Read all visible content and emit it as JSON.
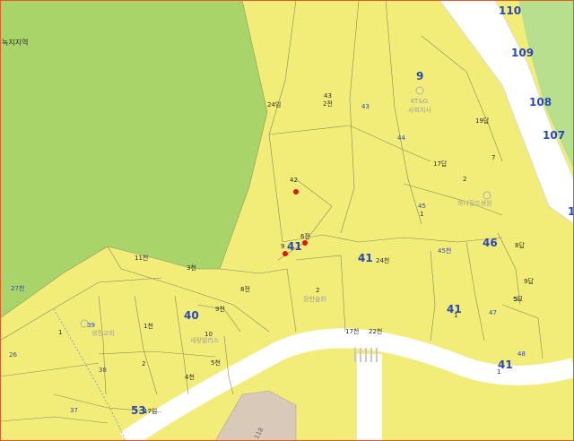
{
  "map": {
    "colors": {
      "residential": "#f2ec78",
      "green_zone": "#a9d46a",
      "east_green": "#b7df8e",
      "road": "#ffffff",
      "parcel_line": "#8a8a55",
      "lot_marker": "#e01414",
      "building": "#d9c9b8",
      "number_label": "#2a48b8",
      "frame": "#e05a2a"
    },
    "zone_label": "녹지지역",
    "road_label": "118",
    "block_numbers": [
      {
        "text": "110",
        "icon": "none"
      },
      {
        "text": "109",
        "icon": "none"
      },
      {
        "text": "108",
        "icon": "none"
      },
      {
        "text": "107",
        "icon": "none"
      },
      {
        "text": "1",
        "icon": "none"
      },
      {
        "text": "9",
        "icon": "none"
      },
      {
        "text": "41",
        "icon": "none"
      },
      {
        "text": "41",
        "icon": "none"
      },
      {
        "text": "46",
        "icon": "none"
      },
      {
        "text": "41",
        "icon": "none"
      },
      {
        "text": "41",
        "icon": "none"
      },
      {
        "text": "40",
        "icon": "none"
      },
      {
        "text": "53",
        "icon": "none"
      }
    ],
    "small_blue_numbers": [
      "43",
      "44",
      "45",
      "45천",
      "47",
      "48",
      "39",
      "38",
      "37",
      "26",
      "27천",
      "5"
    ],
    "lot_labels": [
      "24임",
      "43",
      "2전",
      "19답",
      "17답",
      "2",
      "7",
      "42",
      "6전",
      "9",
      "11천",
      "3천",
      "8전",
      "9천",
      "2",
      "1",
      "24천",
      "8답",
      "9답",
      "5묘",
      "1",
      "17천",
      "22천",
      "1",
      "1천",
      "2",
      "10",
      "5천",
      "4천",
      "17임",
      "1"
    ],
    "poi_labels": [
      "KT&G",
      "사회지사",
      "하나힐드생원",
      "장한솔화",
      "생명교회",
      "새랑빌리스"
    ]
  }
}
